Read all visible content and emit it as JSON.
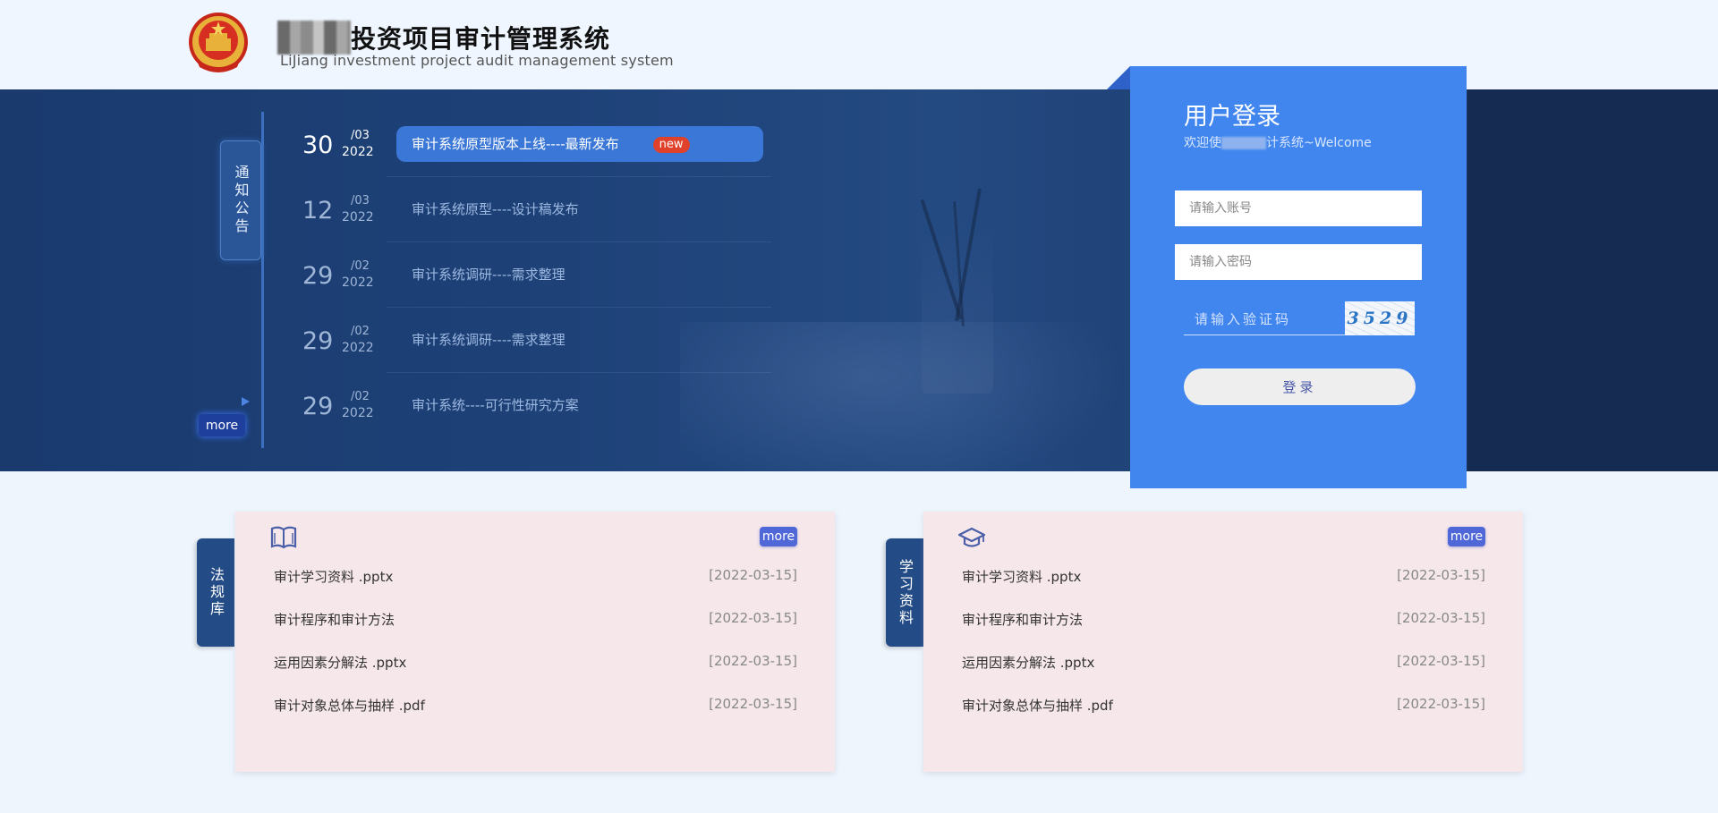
{
  "header": {
    "title": "投资项目审计管理系统",
    "subtitle": "LiJiang investment project audit management system"
  },
  "notice": {
    "tab_label": "通知公告",
    "more_label": "more",
    "items": [
      {
        "day": "30",
        "month": "/03",
        "year": "2022",
        "title": "审计系统原型版本上线----最新发布",
        "badge": "new"
      },
      {
        "day": "12",
        "month": "/03",
        "year": "2022",
        "title": "审计系统原型----设计稿发布"
      },
      {
        "day": "29",
        "month": "/02",
        "year": "2022",
        "title": "审计系统调研----需求整理"
      },
      {
        "day": "29",
        "month": "/02",
        "year": "2022",
        "title": "审计系统调研----需求整理"
      },
      {
        "day": "29",
        "month": "/02",
        "year": "2022",
        "title": "审计系统----可行性研究方案"
      }
    ]
  },
  "login": {
    "title": "用户登录",
    "welcome_prefix": "欢迎使",
    "welcome_suffix": "计系统~Welcome",
    "account_placeholder": "请输入账号",
    "password_placeholder": "请输入密码",
    "captcha_placeholder": "请输入验证码",
    "captcha_code": "3529",
    "submit_label": "登录"
  },
  "law_library": {
    "tab_label": "法规库",
    "icon": "book-icon",
    "more_label": "more",
    "rows": [
      {
        "name": "审计学习资料 .pptx",
        "date": "[2022-03-15]"
      },
      {
        "name": "审计程序和审计方法",
        "date": "[2022-03-15]"
      },
      {
        "name": "运用因素分解法 .pptx",
        "date": "[2022-03-15]"
      },
      {
        "name": "审计对象总体与抽样 .pdf",
        "date": "[2022-03-15]"
      }
    ]
  },
  "study_materials": {
    "tab_label": "学习资料",
    "icon": "graduation-cap-icon",
    "more_label": "more",
    "rows": [
      {
        "name": "审计学习资料 .pptx",
        "date": "[2022-03-15]"
      },
      {
        "name": "审计程序和审计方法",
        "date": "[2022-03-15]"
      },
      {
        "name": "运用因素分解法 .pptx",
        "date": "[2022-03-15]"
      },
      {
        "name": "审计对象总体与抽样 .pdf",
        "date": "[2022-03-15]"
      }
    ]
  },
  "colors": {
    "banner": "#1d4177",
    "login_panel": "#4186ee",
    "card_bg": "#f6e7ea",
    "card_tab": "#234b86",
    "badge_new": "#e0412b",
    "more_button": "#5067d8"
  }
}
